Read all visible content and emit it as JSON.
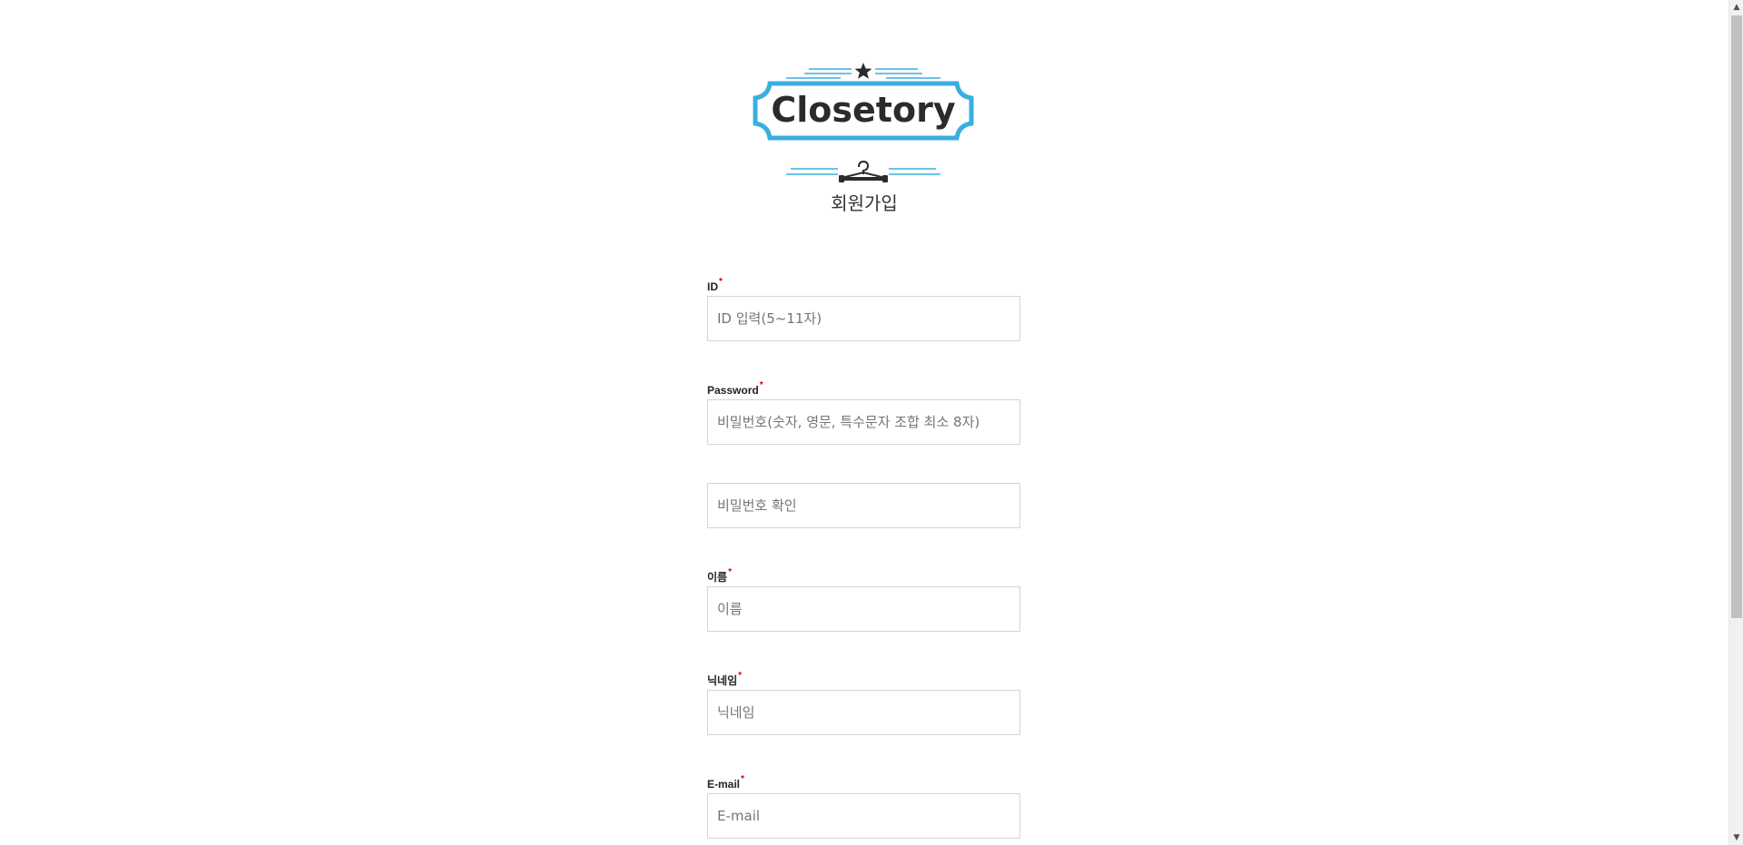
{
  "logo": {
    "text": "Closetory",
    "colors": {
      "frame": "#3aaee0",
      "text": "#2b2b2b",
      "ornament": "#2b2b2b"
    }
  },
  "page_title": "회원가입",
  "form": {
    "id": {
      "label": "ID",
      "required": "*",
      "placeholder": "ID 입력(5~11자)",
      "value": ""
    },
    "password": {
      "label": "Password",
      "required": "*",
      "placeholder": "비밀번호(숫자, 영문, 특수문자 조합 최소 8자)",
      "value": ""
    },
    "password_confirm": {
      "placeholder": "비밀번호 확인",
      "value": ""
    },
    "name": {
      "label": "이름",
      "required": "*",
      "placeholder": "이름",
      "value": ""
    },
    "nickname": {
      "label": "닉네임",
      "required": "*",
      "placeholder": "닉네임",
      "value": ""
    },
    "email": {
      "label": "E-mail",
      "required": "*",
      "placeholder": "E-mail",
      "value": ""
    }
  },
  "scrollbar": {
    "up_glyph": "▲",
    "down_glyph": "▼"
  }
}
